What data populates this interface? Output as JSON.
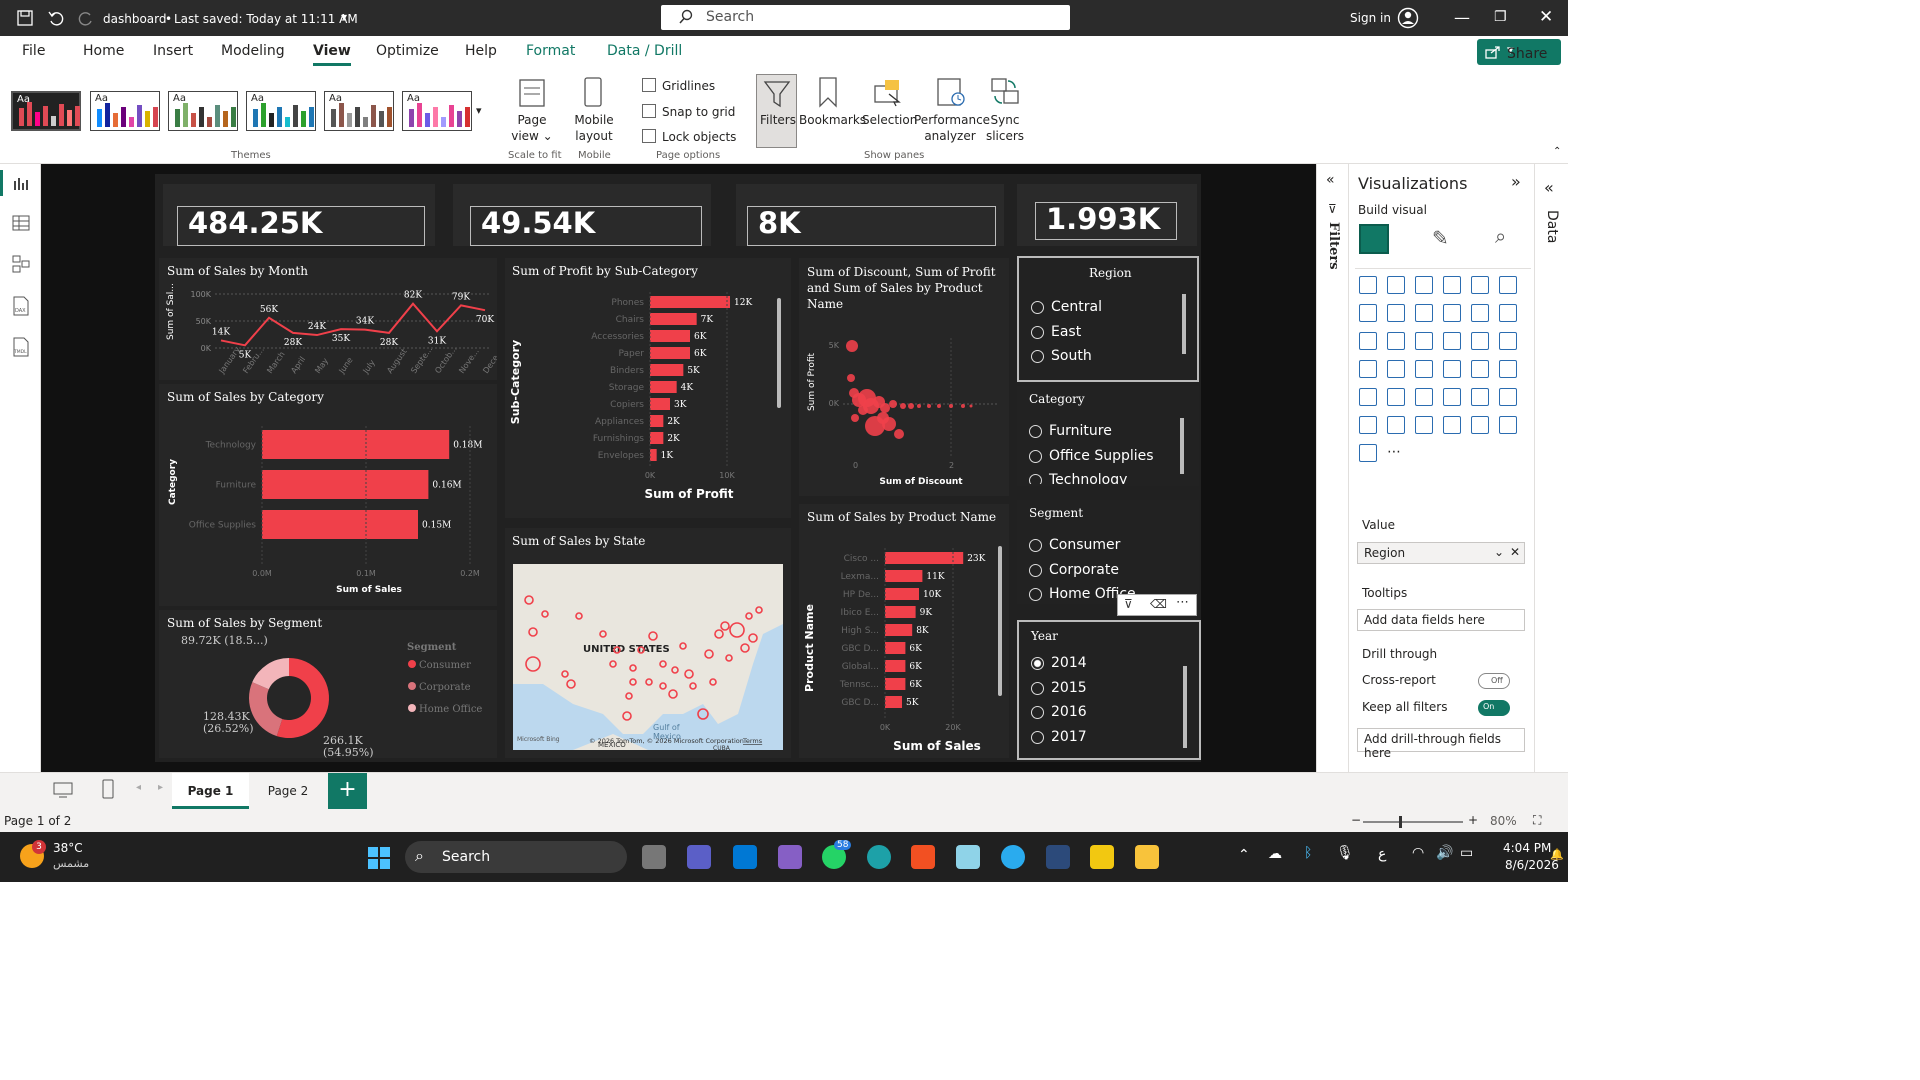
{
  "app": {
    "file_name": "dashboard",
    "saved_status": "Last saved: Today at 11:11 AM",
    "search_placeholder": "Search",
    "sign_in": "Sign in",
    "share_label": "Share"
  },
  "ribbon_tabs": [
    "File",
    "Home",
    "Insert",
    "Modeling",
    "View",
    "Optimize",
    "Help",
    "Format",
    "Data / Drill"
  ],
  "ribbon": {
    "themes_label": "Themes",
    "theme_aa": "Aa",
    "page_view": [
      "Page",
      "view ⌄"
    ],
    "scale_to_fit": "Scale to fit",
    "mobile_layout": [
      "Mobile",
      "layout"
    ],
    "mobile": "Mobile",
    "gridlines": "Gridlines",
    "snap_to_grid": "Snap to grid",
    "lock_objects": "Lock objects",
    "page_options": "Page options",
    "filters": "Filters",
    "bookmarks": "Bookmarks",
    "selection": "Selection",
    "performance": [
      "Performance",
      "analyzer"
    ],
    "sync": [
      "Sync",
      "slicers"
    ],
    "show_panes": "Show panes"
  },
  "kpis": [
    "484.25K",
    "49.54K",
    "8K",
    "1.993K"
  ],
  "visuals": {
    "sales_month": {
      "title": "Sum of Sales by Month",
      "ylabel": "Sum of Sal...",
      "yticks": [
        "100K",
        "50K",
        "0K"
      ],
      "months": [
        "January",
        "Febru...",
        "March",
        "April",
        "May",
        "June",
        "July",
        "August",
        "Septe...",
        "Octob...",
        "Nove...",
        "Dece..."
      ],
      "labels": [
        "14K",
        "5K",
        "56K",
        "28K",
        "24K",
        "35K",
        "34K",
        "28K",
        "82K",
        "31K",
        "79K",
        "70K"
      ],
      "values": [
        14,
        5,
        56,
        28,
        24,
        35,
        34,
        28,
        82,
        31,
        79,
        70
      ]
    },
    "profit_subcat": {
      "title": "Sum of Profit by Sub-Category",
      "ylabel": "Sub-Category",
      "xlabel": "Sum of Profit",
      "xticks": [
        "0K",
        "10K"
      ],
      "categories": [
        "Phones",
        "Chairs",
        "Accessories",
        "Paper",
        "Binders",
        "Storage",
        "Copiers",
        "Appliances",
        "Furnishings",
        "Envelopes"
      ],
      "labels": [
        "12K",
        "7K",
        "6K",
        "6K",
        "5K",
        "4K",
        "3K",
        "2K",
        "2K",
        "1K"
      ],
      "values": [
        12,
        7,
        6,
        6,
        5,
        4,
        3,
        2,
        2,
        1
      ]
    },
    "discount_scatter": {
      "title": "Sum of Discount, Sum of Profit and Sum of Sales by Product Name",
      "ylabel": "Sum of Profit",
      "xlabel": "Sum of Discount",
      "yticks": [
        "5K",
        "0K"
      ],
      "xticks": [
        "0",
        "2"
      ]
    },
    "sales_category": {
      "title": "Sum of Sales by Category",
      "ylabel": "Category",
      "xlabel": "Sum of Sales",
      "xticks": [
        "0.0M",
        "0.1M",
        "0.2M"
      ],
      "categories": [
        "Technology",
        "Furniture",
        "Office Supplies"
      ],
      "labels": [
        "0.18M",
        "0.16M",
        "0.15M"
      ],
      "values": [
        0.18,
        0.16,
        0.15
      ]
    },
    "sales_state": {
      "title": "Sum of Sales by State",
      "country": "UNITED STATES",
      "gulf": "Gulf of\nMexico",
      "mexico": "MEXICO",
      "cuba": "CUBA",
      "credit": "© 2026 TomTom, © 2026 Microsoft Corporation",
      "terms": "Terms",
      "bing": "Microsoft Bing"
    },
    "sales_product": {
      "title": "Sum of Sales by Product Name",
      "ylabel": "Product Name",
      "xlabel": "Sum of Sales",
      "xticks": [
        "0K",
        "20K"
      ],
      "categories": [
        "Cisco ...",
        "Lexma...",
        "HP De...",
        "Ibico E...",
        "High S...",
        "GBC D...",
        "Global...",
        "Tennsc...",
        "GBC D..."
      ],
      "labels": [
        "23K",
        "11K",
        "10K",
        "9K",
        "8K",
        "6K",
        "6K",
        "6K",
        "5K"
      ],
      "values": [
        23,
        11,
        10,
        9,
        8,
        6,
        6,
        6,
        5
      ]
    },
    "sales_segment": {
      "title": "Sum of Sales by Segment",
      "legend_title": "Segment",
      "segments": [
        "Consumer",
        "Corporate",
        "Home Office"
      ],
      "label_a": "89.72K (18.5...)",
      "label_b": "128.43K\n(26.52%)",
      "label_c": "266.1K\n(54.95%)",
      "values": [
        266.1,
        128.43,
        89.72
      ]
    }
  },
  "slicers": {
    "region": {
      "title": "Region",
      "items": [
        "Central",
        "East",
        "South"
      ]
    },
    "category": {
      "title": "Category",
      "items": [
        "Furniture",
        "Office Supplies",
        "Technology"
      ]
    },
    "segment": {
      "title": "Segment",
      "items": [
        "Consumer",
        "Corporate",
        "Home Office"
      ]
    },
    "year": {
      "title": "Year",
      "items": [
        "2014",
        "2015",
        "2016",
        "2017"
      ],
      "selected": "2014"
    }
  },
  "filters_label": "Filters",
  "visualizations": {
    "title": "Visualizations",
    "build_visual": "Build visual",
    "value_label": "Value",
    "value_field": "Region",
    "tooltips_label": "Tooltips",
    "tooltips_placeholder": "Add data fields here",
    "drill_through": "Drill through",
    "cross_report": "Cross-report",
    "cross_state": "Off",
    "keep_filters": "Keep all filters",
    "keep_state": "On",
    "drill_placeholder": "Add drill-through fields here",
    "data_label": "Data"
  },
  "pages": [
    "Page 1",
    "Page 2"
  ],
  "status": {
    "page_of": "Page 1 of 2",
    "zoom": "80%"
  },
  "taskbar": {
    "temp": "38°C",
    "weather_desc": "مشمس",
    "weather_badge": "3",
    "search": "Search",
    "whatsapp_badge": "58",
    "lang": "ع",
    "time": "4:04 PM",
    "date": "8/6/2026"
  },
  "colors": {
    "accent": "#f0404a",
    "dark": "#212121",
    "share": "#117865"
  }
}
